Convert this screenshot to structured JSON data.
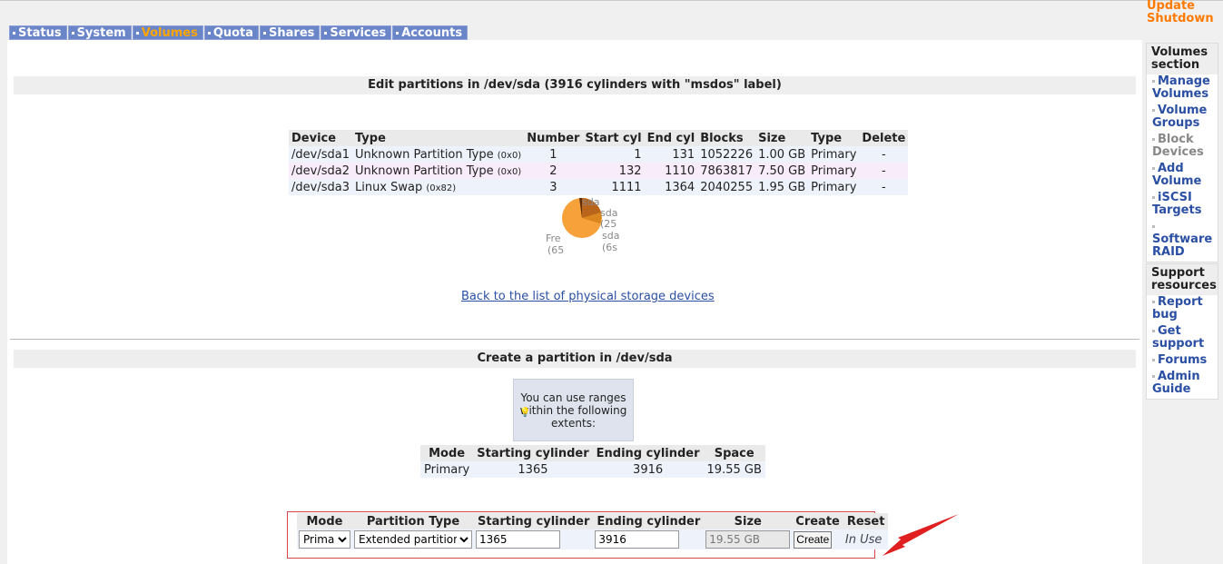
{
  "tabs": [
    {
      "label": "Status",
      "active": false
    },
    {
      "label": "System",
      "active": false
    },
    {
      "label": "Volumes",
      "active": true
    },
    {
      "label": "Quota",
      "active": false
    },
    {
      "label": "Shares",
      "active": false
    },
    {
      "label": "Services",
      "active": false
    },
    {
      "label": "Accounts",
      "active": false
    }
  ],
  "top_links": {
    "update": "Update",
    "shutdown": "Shutdown"
  },
  "edit_title": "Edit partitions in /dev/sda (3916 cylinders with \"msdos\" label)",
  "partition_headers": [
    "Device",
    "Type",
    "Number",
    "Start cyl",
    "End cyl",
    "Blocks",
    "Size",
    "Type",
    "Delete"
  ],
  "partitions": [
    {
      "device": "/dev/sda1",
      "type": "Unknown Partition Type",
      "code": "(0x0)",
      "number": "1",
      "start": "1",
      "end": "131",
      "blocks": "1052226",
      "size": "1.00 GB",
      "ptype": "Primary",
      "delete": "-"
    },
    {
      "device": "/dev/sda2",
      "type": "Unknown Partition Type",
      "code": "(0x0)",
      "number": "2",
      "start": "132",
      "end": "1110",
      "blocks": "7863817",
      "size": "7.50 GB",
      "ptype": "Primary",
      "delete": "-"
    },
    {
      "device": "/dev/sda3",
      "type": "Linux Swap",
      "code": "(0x82)",
      "number": "3",
      "start": "1111",
      "end": "1364",
      "blocks": "2040255",
      "size": "1.95 GB",
      "ptype": "Primary",
      "delete": "-"
    }
  ],
  "pie_labels": {
    "l1": "sda",
    "l2": "sda",
    "l3": "(25",
    "l4": "sda",
    "l5": "(6s",
    "free": "Fre",
    "free_pct": "(65"
  },
  "colors": {
    "free": "#f7a13a",
    "sda1": "#5c2e00",
    "sda2": "#b8641a",
    "sda3": "#d9861e"
  },
  "back_link": "Back to the list of physical storage devices",
  "create_title": "Create a partition in /dev/sda",
  "info_text": "You can use ranges within the following extents:",
  "extent_headers": [
    "Mode",
    "Starting cylinder",
    "Ending cylinder",
    "Space"
  ],
  "extent_row": {
    "mode": "Primary",
    "start": "1365",
    "end": "3916",
    "space": "19.55 GB"
  },
  "form_headers": [
    "Mode",
    "Partition Type",
    "Starting cylinder",
    "Ending cylinder",
    "Size",
    "Create",
    "Reset"
  ],
  "form": {
    "mode": "Primary",
    "ptype": "Extended partition",
    "start": "1365",
    "end": "3916",
    "size": "19.55 GB",
    "create": "Create",
    "reset": "In Use"
  },
  "volumes_section": {
    "title": "Volumes section",
    "items": [
      {
        "label": "Manage Volumes",
        "disabled": false
      },
      {
        "label": "Volume Groups",
        "disabled": false
      },
      {
        "label": "Block Devices",
        "disabled": true
      },
      {
        "label": "Add Volume",
        "disabled": false
      },
      {
        "label": "iSCSI Targets",
        "disabled": false
      },
      {
        "label": "Software RAID",
        "disabled": false
      }
    ]
  },
  "support_section": {
    "title": "Support resources",
    "items": [
      {
        "label": "Report bug"
      },
      {
        "label": "Get support"
      },
      {
        "label": "Forums"
      },
      {
        "label": "Admin Guide"
      }
    ]
  }
}
